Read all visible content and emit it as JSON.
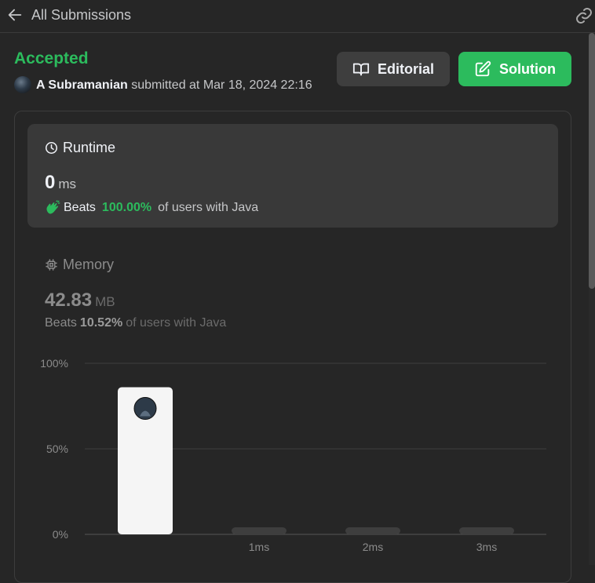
{
  "topbar": {
    "title": "All Submissions"
  },
  "submission": {
    "status": "Accepted",
    "user": "A Subramanian",
    "submitted_text": "submitted at Mar 18, 2024 22:16"
  },
  "actions": {
    "editorial_label": "Editorial",
    "solution_label": "Solution"
  },
  "runtime": {
    "title": "Runtime",
    "value": "0",
    "unit": "ms",
    "beats_label": "Beats",
    "beats_pct": "100.00%",
    "beats_suffix": "of users with Java"
  },
  "memory": {
    "title": "Memory",
    "value": "42.83",
    "unit": "MB",
    "beats_label": "Beats",
    "beats_pct": "10.52%",
    "beats_suffix": "of users with Java"
  },
  "colors": {
    "accent_green": "#2cbb5d",
    "bar_highlight": "#f5f5f5",
    "bar_dim": "#3e3e3e"
  },
  "chart_data": {
    "type": "bar",
    "categories": [
      "",
      "1ms",
      "2ms",
      "3ms"
    ],
    "values": [
      86,
      2,
      1,
      1
    ],
    "highlighted_index": 0,
    "y_ticks": [
      "0%",
      "50%",
      "100%"
    ],
    "ylim": [
      0,
      100
    ],
    "xlabel": "",
    "ylabel": "",
    "grid": true
  }
}
